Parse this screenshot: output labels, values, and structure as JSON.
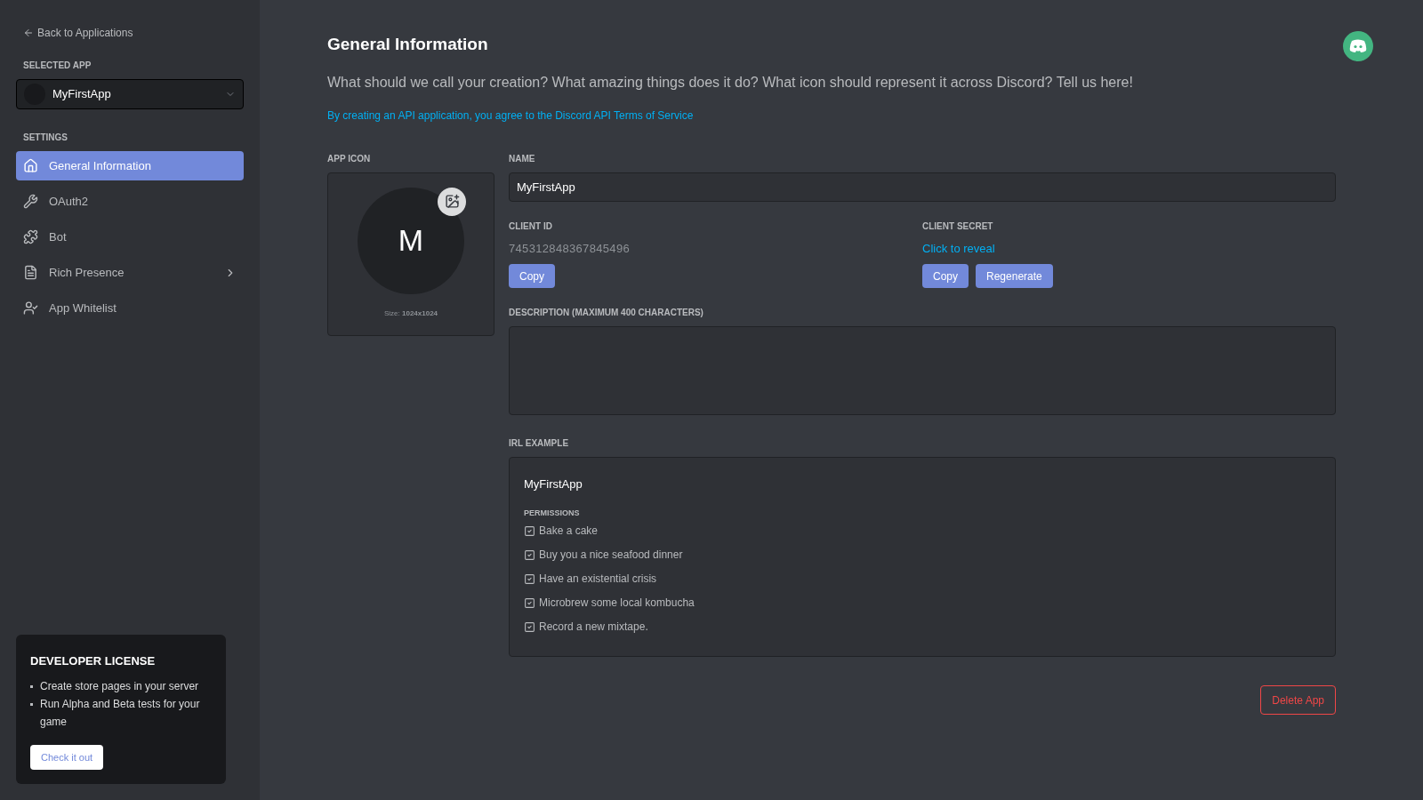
{
  "sidebar": {
    "back_link": "Back to Applications",
    "selected_app_label": "SELECTED APP",
    "selected_app": "MyFirstApp",
    "settings_label": "SETTINGS",
    "items": [
      {
        "label": "General Information",
        "selected": true
      },
      {
        "label": "OAuth2",
        "selected": false
      },
      {
        "label": "Bot",
        "selected": false
      },
      {
        "label": "Rich Presence",
        "selected": false
      },
      {
        "label": "App Whitelist",
        "selected": false
      }
    ],
    "license_card": {
      "title": "DEVELOPER LICENSE",
      "bullets": [
        "Create store pages in your server",
        "Run Alpha and Beta tests for your game"
      ],
      "button": "Check it out"
    }
  },
  "main": {
    "title": "General Information",
    "subtitle": "What should we call your creation? What amazing things does it do? What icon should represent it across Discord? Tell us here!",
    "terms_link": "By creating an API application, you agree to the Discord API Terms of Service",
    "app_icon": {
      "label": "APP ICON",
      "initial": "M",
      "size": "Size: **1024x1024**"
    },
    "name": {
      "label": "NAME",
      "value": "MyFirstApp"
    },
    "client_id": {
      "label": "CLIENT ID",
      "value": "745312848367845496",
      "buttons": [
        "Copy"
      ]
    },
    "client_secret": {
      "label": "CLIENT SECRET",
      "reveal": "Click to reveal",
      "buttons": [
        "Copy",
        "Regenerate"
      ]
    },
    "description": {
      "label": "DESCRIPTION (MAXIMUM 400 CHARACTERS)"
    },
    "irl_example": {
      "label": "IRL EXAMPLE",
      "app_name": "MyFirstApp",
      "permissions_label": "PERMISSIONS",
      "permissions": [
        {
          "label": "Bake a cake",
          "checked": true
        },
        {
          "label": "Buy you a nice seafood dinner",
          "checked": true
        },
        {
          "label": "Have an existential crisis",
          "checked": true
        },
        {
          "label": "Microbrew some local kombucha",
          "checked": true
        },
        {
          "label": "Record a new mixtape.",
          "checked": true
        }
      ]
    },
    "delete_button": "Delete App"
  }
}
